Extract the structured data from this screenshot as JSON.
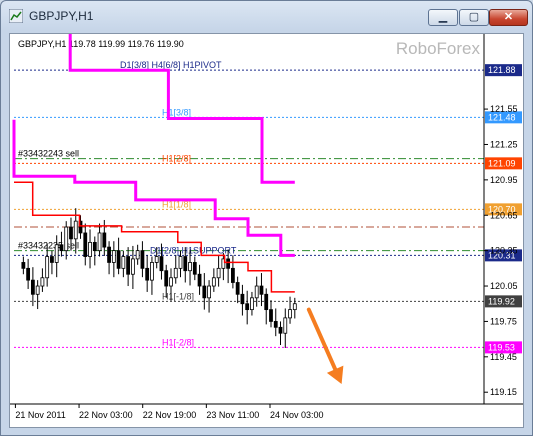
{
  "window": {
    "title": "GBPJPY,H1"
  },
  "ohlc_header": "GBPJPY,H1  119.78 119.99 119.76 119.90",
  "watermark": "RoboForex",
  "colors": {
    "pivot": "#ff00ff",
    "support": "#ff0000",
    "arrow": "#f57d20",
    "sell": "#2e8b2e"
  },
  "chart_data": {
    "type": "candlestick",
    "symbol": "GBPJPY",
    "timeframe": "H1",
    "ohlc": {
      "open": 119.78,
      "high": 119.99,
      "low": 119.76,
      "close": 119.9
    },
    "ylim": [
      119.05,
      122.0
    ],
    "y_ticks": [
      121.88,
      121.55,
      121.48,
      121.25,
      121.09,
      120.95,
      120.7,
      120.65,
      120.35,
      120.31,
      120.05,
      119.92,
      119.75,
      119.53,
      119.45,
      119.15
    ],
    "x_ticks": [
      "21 Nov 2011",
      "22 Nov 03:00",
      "22 Nov 19:00",
      "23 Nov 11:00",
      "24 Nov 03:00"
    ],
    "levels": [
      {
        "label": "D1[3/8] H4[6/8] H1PIVOT",
        "value": 121.88,
        "color": "#1b2a8a",
        "style": "dotted",
        "badge": true
      },
      {
        "label": "H1[3/8]",
        "value": 121.48,
        "color": "#3399ff",
        "style": "dotted",
        "badge": true
      },
      {
        "label": "#33432243 sell",
        "value": 121.13,
        "color": "#2e8b2e",
        "style": "dashdot",
        "badge": false
      },
      {
        "label": "H1[2/8]",
        "value": 121.09,
        "color": "#ff4400",
        "style": "dotted",
        "badge": true
      },
      {
        "label": "H1[1/8]",
        "value": 120.7,
        "color": "#f0a030",
        "style": "dotted",
        "badge": true
      },
      {
        "label": "",
        "value": 120.55,
        "color": "#b0503a",
        "style": "dashdot",
        "badge": false
      },
      {
        "label": "#33432235 sell",
        "value": 120.35,
        "color": "#2e8b2e",
        "style": "dashdot",
        "badge": false
      },
      {
        "label": "D1[2/8] H1SUPPORT",
        "value": 120.31,
        "color": "#1b2a8a",
        "style": "dotted",
        "badge": true
      },
      {
        "label": "H1[-1/8]",
        "value": 119.92,
        "color": "#404040",
        "style": "dotted",
        "badge": true
      },
      {
        "label": "H1[-2/8]",
        "value": 119.53,
        "color": "#ff00ff",
        "style": "dotted",
        "badge": true
      }
    ],
    "plain_ticks": [
      121.55,
      121.25,
      120.95,
      120.65,
      120.35,
      120.05,
      119.75,
      119.45,
      119.15
    ],
    "pivot_line": [
      [
        0,
        122.2
      ],
      [
        0.12,
        122.2
      ],
      [
        0.12,
        121.88
      ],
      [
        0.33,
        121.88
      ],
      [
        0.33,
        121.47
      ],
      [
        0.53,
        121.47
      ],
      [
        0.53,
        120.93
      ],
      [
        0.6,
        120.93
      ]
    ],
    "pivot_line2": [
      [
        0,
        121.46
      ],
      [
        0,
        120.98
      ],
      [
        0.13,
        120.98
      ],
      [
        0.13,
        120.93
      ],
      [
        0.26,
        120.93
      ],
      [
        0.26,
        120.78
      ],
      [
        0.43,
        120.78
      ],
      [
        0.43,
        120.62
      ],
      [
        0.5,
        120.62
      ],
      [
        0.5,
        120.48
      ],
      [
        0.57,
        120.48
      ],
      [
        0.57,
        120.31
      ],
      [
        0.6,
        120.31
      ]
    ],
    "support_line": [
      [
        0,
        120.93
      ],
      [
        0.04,
        120.93
      ],
      [
        0.04,
        120.65
      ],
      [
        0.14,
        120.65
      ],
      [
        0.14,
        120.56
      ],
      [
        0.23,
        120.56
      ],
      [
        0.23,
        120.51
      ],
      [
        0.35,
        120.51
      ],
      [
        0.35,
        120.42
      ],
      [
        0.4,
        120.42
      ],
      [
        0.4,
        120.31
      ],
      [
        0.45,
        120.31
      ],
      [
        0.45,
        120.25
      ],
      [
        0.5,
        120.25
      ],
      [
        0.5,
        120.18
      ],
      [
        0.55,
        120.18
      ],
      [
        0.55,
        120.0
      ],
      [
        0.6,
        120.0
      ]
    ],
    "closes": [
      120.2,
      120.1,
      119.98,
      120.05,
      120.12,
      120.3,
      120.25,
      120.4,
      120.35,
      120.55,
      120.45,
      120.6,
      120.5,
      120.3,
      120.42,
      120.35,
      120.5,
      120.38,
      120.25,
      120.35,
      120.2,
      120.3,
      120.15,
      120.28,
      120.35,
      120.2,
      120.1,
      120.25,
      120.3,
      120.18,
      120.05,
      120.12,
      120.2,
      120.3,
      120.18,
      120.25,
      120.15,
      120.05,
      119.95,
      120.05,
      120.12,
      120.2,
      120.28,
      120.2,
      120.08,
      119.98,
      119.9,
      119.85,
      119.95,
      120.05,
      119.98,
      119.85,
      119.75,
      119.7,
      119.65,
      119.78,
      119.85,
      119.9
    ],
    "forecast_arrow": {
      "from": [
        0.63,
        119.85
      ],
      "to": [
        0.7,
        119.22
      ]
    }
  }
}
